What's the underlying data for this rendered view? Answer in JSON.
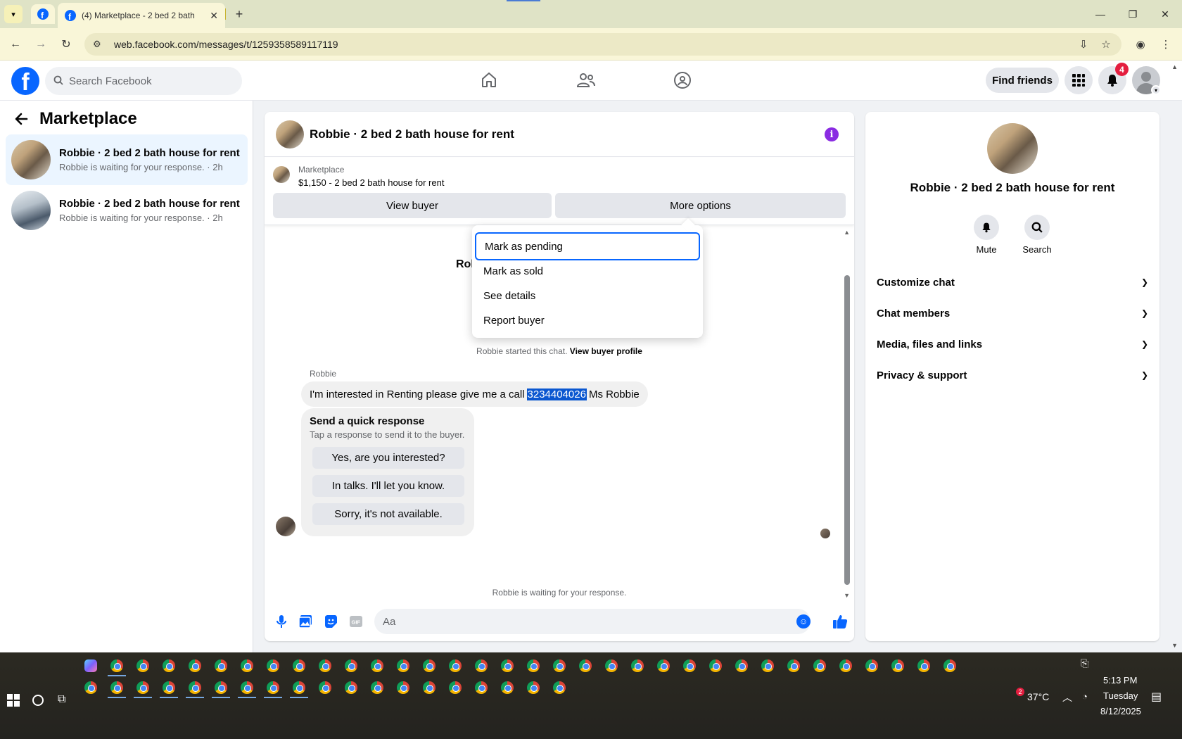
{
  "browser": {
    "tab_title": "(4) Marketplace - 2 bed 2 bath",
    "url": "web.facebook.com/messages/t/1259358589117119"
  },
  "fb": {
    "search_placeholder": "Search Facebook",
    "find_friends": "Find friends",
    "notif_count": "4"
  },
  "sidebar": {
    "title": "Marketplace",
    "conversations": [
      {
        "title": "Robbie · 2 bed 2 bath house for rent",
        "subtitle": "Robbie is waiting for your response. · 2h"
      },
      {
        "title": "Robbie · 2 bed 2 bath house for rent",
        "subtitle": "Robbie is waiting for your response. · 2h"
      }
    ]
  },
  "chat": {
    "title": "Robbie · 2 bed 2 bath house for rent",
    "listing_kind": "Marketplace",
    "listing_price": "$1,150 - 2 bed 2 bath house for rent",
    "view_buyer": "View buyer",
    "more_options": "More options",
    "partial_name": "Rol",
    "started_text": "Robbie started this chat.",
    "view_profile": "View buyer profile",
    "sender": "Robbie",
    "message_before": "I'm interested in Renting please give me a call",
    "message_phone": "3234404026",
    "message_after": "Ms Robbie",
    "quick_title": "Send a quick response",
    "quick_sub": "Tap a response to send it to the buyer.",
    "quick_replies": [
      "Yes, are you interested?",
      "In talks. I'll let you know.",
      "Sorry, it's not available."
    ],
    "waiting": "Robbie is waiting for your response.",
    "composer_placeholder": "Aa"
  },
  "menu": {
    "items": [
      "Mark as pending",
      "Mark as sold",
      "See details",
      "Report buyer"
    ]
  },
  "rpanel": {
    "name": "Robbie · 2 bed 2 bath house for rent",
    "mute": "Mute",
    "search": "Search",
    "sections": [
      "Customize chat",
      "Chat members",
      "Media, files and links",
      "Privacy & support"
    ]
  },
  "taskbar": {
    "notif_badge": "2",
    "temperature": "37°C",
    "time": "5:13 PM",
    "day": "Tuesday",
    "date": "8/12/2025"
  }
}
